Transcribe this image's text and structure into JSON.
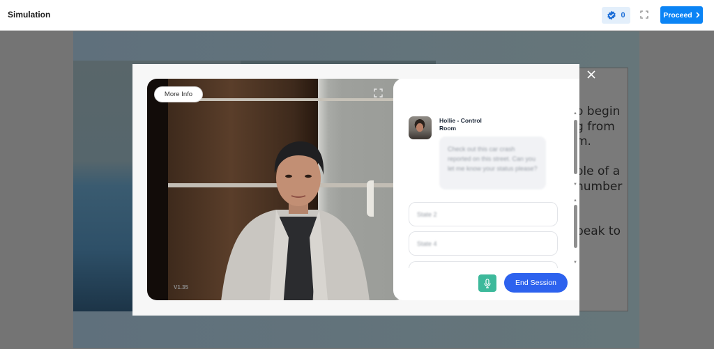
{
  "topbar": {
    "title": "Simulation",
    "badge_count": "0",
    "badge_icon": "verified-check-icon",
    "fullscreen_icon": "fullscreen-icon",
    "proceed_label": "Proceed",
    "proceed_icon": "chevron-right-icon"
  },
  "background_page": {
    "text_fragment": "o begin\ng from\nm.\n\nole of a\nnumber\n\n\npeak to\n."
  },
  "modal": {
    "close_icon": "close-icon",
    "video": {
      "more_info_label": "More Info",
      "fullscreen_icon": "fullscreen-icon",
      "version": "V1.35"
    },
    "chat": {
      "sender_name": "Hollie - Control Room",
      "message": "Check out this car crash reported on this street. Can you let me know your status please?",
      "options": [
        {
          "label": "State 2"
        },
        {
          "label": "State 4"
        },
        {
          "label": ""
        }
      ],
      "mic_icon": "microphone-icon",
      "end_session_label": "End Session"
    }
  },
  "colors": {
    "proceed": "#0b84f5",
    "end_session": "#2d62ee",
    "mic": "#3db99b",
    "badge_bg": "#e3effb"
  }
}
